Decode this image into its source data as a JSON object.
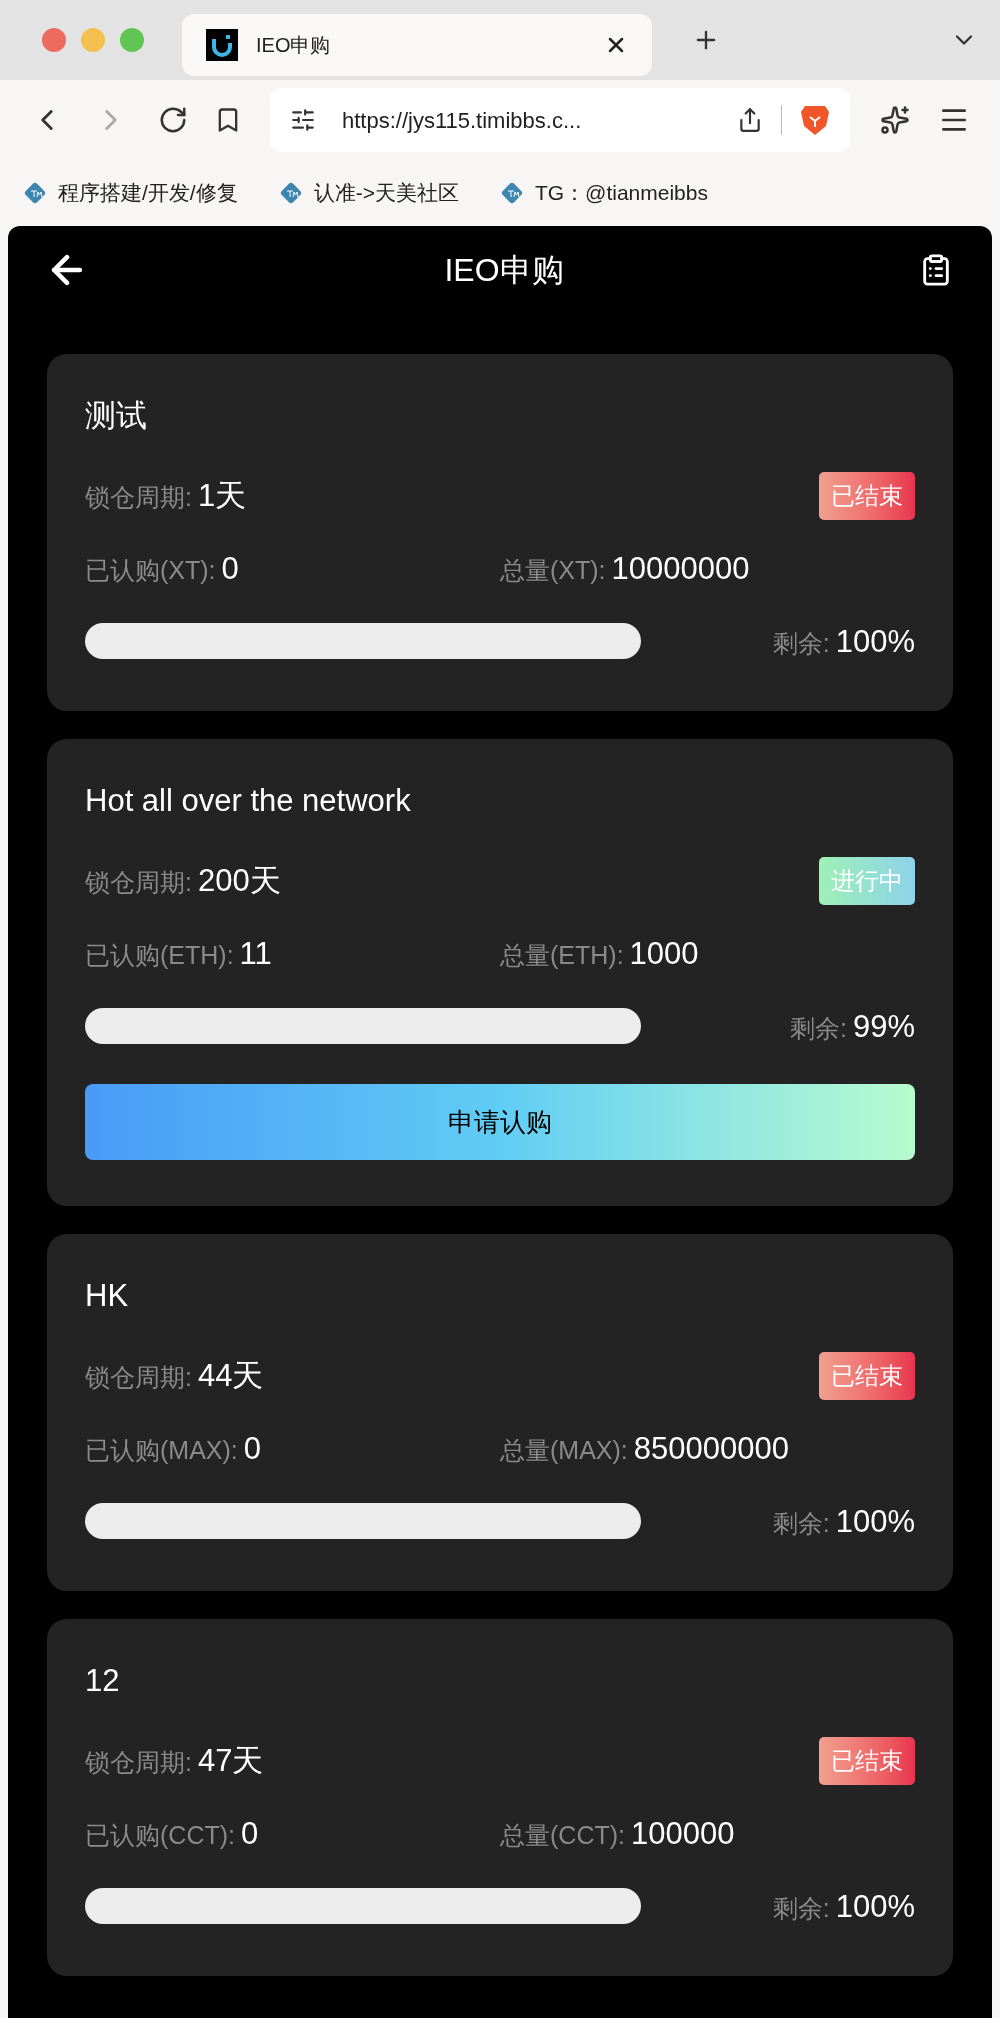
{
  "browser": {
    "tab": {
      "title": "IEO申购"
    },
    "url": "https://jys115.timibbs.c...",
    "bookmarks": [
      "程序搭建/开发/修复",
      "认准->天美社区",
      "TG：@tianmeibbs"
    ]
  },
  "header": {
    "title": "IEO申购"
  },
  "cards": [
    {
      "name": "测试",
      "lock_label": "锁仓周期:",
      "lock_value": "1天",
      "status": {
        "kind": "ended",
        "label": "已结束"
      },
      "subscribed_label": "已认购(XT):",
      "subscribed_value": "0",
      "total_label": "总量(XT):",
      "total_value": "10000000",
      "level": 0,
      "remaining_label": "剩余:",
      "remaining_value": "100%"
    },
    {
      "name": "Hot all over the network",
      "lock_label": "锁仓周期:",
      "lock_value": "200天",
      "status": {
        "kind": "ongoing",
        "label": "进行中"
      },
      "subscribed_label": "已认购(ETH):",
      "subscribed_value": "11",
      "total_label": "总量(ETH):",
      "total_value": "1000",
      "level": 0,
      "remaining_label": "剩余:",
      "remaining_value": "99%",
      "button": "申请认购"
    },
    {
      "name": "HK",
      "lock_label": "锁仓周期:",
      "lock_value": "44天",
      "status": {
        "kind": "ended",
        "label": "已结束"
      },
      "subscribed_label": "已认购(MAX):",
      "subscribed_value": "0",
      "total_label": "总量(MAX):",
      "total_value": "850000000",
      "level": 0,
      "remaining_label": "剩余:",
      "remaining_value": "100%"
    },
    {
      "name": "12",
      "lock_label": "锁仓周期:",
      "lock_value": "47天",
      "status": {
        "kind": "ended",
        "label": "已结束"
      },
      "subscribed_label": "已认购(CCT):",
      "subscribed_value": "0",
      "total_label": "总量(CCT):",
      "total_value": "100000",
      "level": 0,
      "remaining_label": "剩余:",
      "remaining_value": "100%"
    }
  ]
}
